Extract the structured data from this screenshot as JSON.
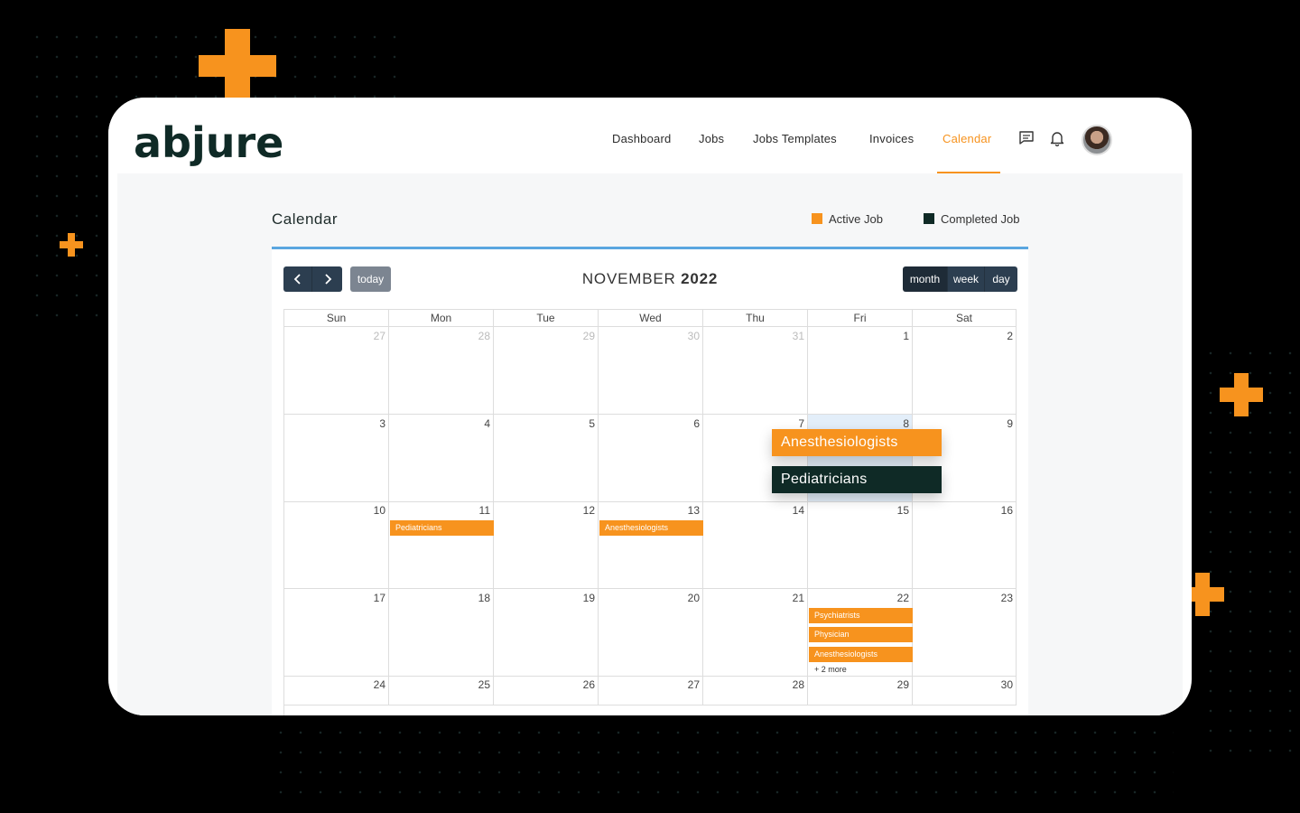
{
  "brand": {
    "logo_text": "abjure",
    "accent": "#f7931e",
    "dark": "#0f2a26"
  },
  "nav": {
    "items": [
      {
        "label": "Dashboard",
        "active": false
      },
      {
        "label": "Jobs",
        "active": false
      },
      {
        "label": "Jobs Templates",
        "active": false
      },
      {
        "label": "Invoices",
        "active": false
      },
      {
        "label": "Calendar",
        "active": true
      }
    ],
    "icons": [
      "message-icon",
      "bell-icon",
      "user-avatar"
    ]
  },
  "page": {
    "title": "Calendar"
  },
  "legend": [
    {
      "label": "Active Job",
      "color": "#f7931e"
    },
    {
      "label": "Completed Job",
      "color": "#0f2a26"
    }
  ],
  "toolbar": {
    "prev_icon": "chevron-left-icon",
    "next_icon": "chevron-right-icon",
    "today_label": "today",
    "month_name": "NOVEMBER",
    "year": "2022",
    "views": [
      {
        "label": "month",
        "active": true
      },
      {
        "label": "week",
        "active": false
      },
      {
        "label": "day",
        "active": false
      }
    ]
  },
  "calendar": {
    "weekdays": [
      "Sun",
      "Mon",
      "Tue",
      "Wed",
      "Thu",
      "Fri",
      "Sat"
    ],
    "weeks": [
      [
        "27",
        "28",
        "29",
        "30",
        "31",
        "1",
        "2"
      ],
      [
        "3",
        "4",
        "5",
        "6",
        "7",
        "8",
        "9"
      ],
      [
        "10",
        "11",
        "12",
        "13",
        "14",
        "15",
        "16"
      ],
      [
        "17",
        "18",
        "19",
        "20",
        "21",
        "22",
        "23"
      ],
      [
        "24",
        "25",
        "26",
        "27",
        "28",
        "29",
        "30"
      ]
    ],
    "events": [
      {
        "title": "Pediatricians",
        "date": "11"
      },
      {
        "title": "Anesthesiologists",
        "date": "13"
      },
      {
        "title": "Psychiatrists",
        "date": "22"
      },
      {
        "title": "Physician",
        "date": "22"
      },
      {
        "title": "Anesthesiologists",
        "date": "22"
      }
    ],
    "more_label": "+ 2 more",
    "popup": [
      {
        "title": "Anesthesiologists",
        "status": "active"
      },
      {
        "title": "Pediatricians",
        "status": "completed"
      }
    ]
  }
}
